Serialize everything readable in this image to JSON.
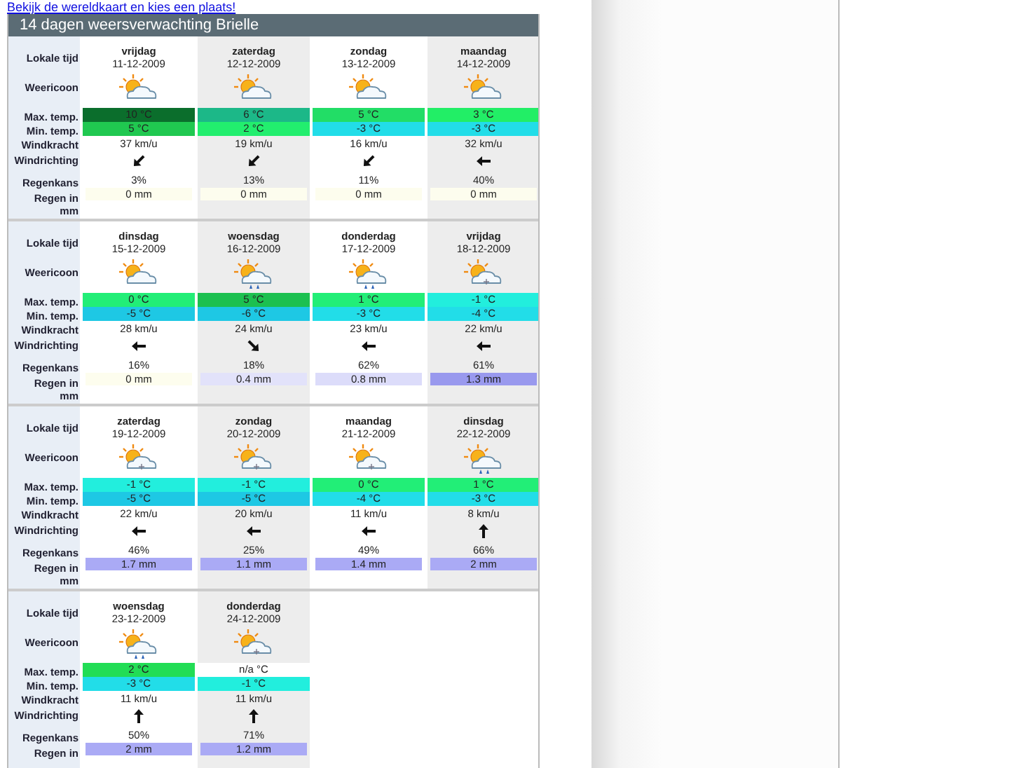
{
  "link": "Bekijk de wereldkaart en kies een plaats!",
  "title": "14 dagen weersverwachting Brielle",
  "blocks": [
    {
      "labels": [
        "Lokale tijd",
        "Weericoon",
        "Max. temp.",
        "Min. temp.",
        "Windkracht",
        "Windrichting",
        "Regenkans",
        "Regen in mm"
      ],
      "days": [
        {
          "day": "vrijdag",
          "date": "11-12-2009",
          "weather": {
            "kind": "sun-cloud"
          },
          "max": {
            "text": "10 °C",
            "color": "#0b6e2c"
          },
          "min": {
            "text": "5 °C",
            "color": "#20c850"
          },
          "wind": "37 km/u",
          "wind_arrow": {
            "kind": "down-left"
          },
          "chance": "3%",
          "rain": {
            "text": "0 mm",
            "color": "#fdfdee"
          }
        },
        {
          "day": "zaterdag",
          "date": "12-12-2009",
          "weather": {
            "kind": "sun-cloud"
          },
          "max": {
            "text": "6 °C",
            "color": "#1cb888"
          },
          "min": {
            "text": "2 °C",
            "color": "#22ee6e"
          },
          "wind": "19 km/u",
          "wind_arrow": {
            "kind": "down-left"
          },
          "chance": "13%",
          "rain": {
            "text": "0 mm",
            "color": "#fdfdee"
          }
        },
        {
          "day": "zondag",
          "date": "13-12-2009",
          "weather": {
            "kind": "sun-cloud"
          },
          "max": {
            "text": "5 °C",
            "color": "#22dd66"
          },
          "min": {
            "text": "-3 °C",
            "color": "#22dde8"
          },
          "wind": "16 km/u",
          "wind_arrow": {
            "kind": "down-left"
          },
          "chance": "11%",
          "rain": {
            "text": "0 mm",
            "color": "#fdfdee"
          }
        },
        {
          "day": "maandag",
          "date": "14-12-2009",
          "weather": {
            "kind": "sun-cloud"
          },
          "max": {
            "text": "3 °C",
            "color": "#22ee66"
          },
          "min": {
            "text": "-3 °C",
            "color": "#22dde8"
          },
          "wind": "32 km/u",
          "wind_arrow": {
            "kind": "left"
          },
          "chance": "40%",
          "rain": {
            "text": "0 mm",
            "color": "#fdfdee"
          }
        }
      ]
    },
    {
      "labels": [
        "Lokale tijd",
        "Weericoon",
        "Max. temp.",
        "Min. temp.",
        "Windkracht",
        "Windrichting",
        "Regenkans",
        "Regen in mm"
      ],
      "days": [
        {
          "day": "dinsdag",
          "date": "15-12-2009",
          "weather": {
            "kind": "sun-cloud"
          },
          "max": {
            "text": "0 °C",
            "color": "#22ee77"
          },
          "min": {
            "text": "-5 °C",
            "color": "#1ec8e4"
          },
          "wind": "28 km/u",
          "wind_arrow": {
            "kind": "left"
          },
          "chance": "16%",
          "rain": {
            "text": "0 mm",
            "color": "#fdfdee"
          }
        },
        {
          "day": "woensdag",
          "date": "16-12-2009",
          "weather": {
            "kind": "sun-cloud-rain"
          },
          "max": {
            "text": "5 °C",
            "color": "#1cc050"
          },
          "min": {
            "text": "-6 °C",
            "color": "#1ec8e4"
          },
          "wind": "24 km/u",
          "wind_arrow": {
            "kind": "down-right"
          },
          "chance": "18%",
          "rain": {
            "text": "0.4 mm",
            "color": "#e2e2fa"
          }
        },
        {
          "day": "donderdag",
          "date": "17-12-2009",
          "weather": {
            "kind": "sun-cloud-rain"
          },
          "max": {
            "text": "1 °C",
            "color": "#22ee77"
          },
          "min": {
            "text": "-3 °C",
            "color": "#22dde8"
          },
          "wind": "23 km/u",
          "wind_arrow": {
            "kind": "left"
          },
          "chance": "62%",
          "rain": {
            "text": "0.8 mm",
            "color": "#dcdcfa"
          }
        },
        {
          "day": "vrijdag",
          "date": "18-12-2009",
          "weather": {
            "kind": "sun-cloud-snow"
          },
          "max": {
            "text": "-1 °C",
            "color": "#22eedd"
          },
          "min": {
            "text": "-4 °C",
            "color": "#22dde8"
          },
          "wind": "22 km/u",
          "wind_arrow": {
            "kind": "left"
          },
          "chance": "61%",
          "rain": {
            "text": "1.3 mm",
            "color": "#9999ee"
          }
        }
      ]
    },
    {
      "labels": [
        "Lokale tijd",
        "Weericoon",
        "Max. temp.",
        "Min. temp.",
        "Windkracht",
        "Windrichting",
        "Regenkans",
        "Regen in mm"
      ],
      "days": [
        {
          "day": "zaterdag",
          "date": "19-12-2009",
          "weather": {
            "kind": "sun-cloud-snow"
          },
          "max": {
            "text": "-1 °C",
            "color": "#22eedd"
          },
          "min": {
            "text": "-5 °C",
            "color": "#1ec8e4"
          },
          "wind": "22 km/u",
          "wind_arrow": {
            "kind": "left"
          },
          "chance": "46%",
          "rain": {
            "text": "1.7 mm",
            "color": "#aaaaf5"
          }
        },
        {
          "day": "zondag",
          "date": "20-12-2009",
          "weather": {
            "kind": "sun-cloud-snow"
          },
          "max": {
            "text": "-1 °C",
            "color": "#22eedd"
          },
          "min": {
            "text": "-5 °C",
            "color": "#1ec8e4"
          },
          "wind": "20 km/u",
          "wind_arrow": {
            "kind": "left"
          },
          "chance": "25%",
          "rain": {
            "text": "1.1 mm",
            "color": "#aaaaf5"
          }
        },
        {
          "day": "maandag",
          "date": "21-12-2009",
          "weather": {
            "kind": "sun-cloud-snow"
          },
          "max": {
            "text": "0 °C",
            "color": "#22ee77"
          },
          "min": {
            "text": "-4 °C",
            "color": "#22dde8"
          },
          "wind": "11 km/u",
          "wind_arrow": {
            "kind": "left"
          },
          "chance": "49%",
          "rain": {
            "text": "1.4 mm",
            "color": "#aaaaf5"
          }
        },
        {
          "day": "dinsdag",
          "date": "22-12-2009",
          "weather": {
            "kind": "sun-cloud-rain"
          },
          "max": {
            "text": "1 °C",
            "color": "#22ee77"
          },
          "min": {
            "text": "-3 °C",
            "color": "#22dde8"
          },
          "wind": "8 km/u",
          "wind_arrow": {
            "kind": "up"
          },
          "chance": "66%",
          "rain": {
            "text": "2 mm",
            "color": "#aaaaf5"
          }
        }
      ]
    },
    {
      "labels": [
        "Lokale tijd",
        "Weericoon",
        "Max. temp.",
        "Min. temp.",
        "Windkracht",
        "Windrichting",
        "Regenkans",
        "Regen in"
      ],
      "days": [
        {
          "day": "woensdag",
          "date": "23-12-2009",
          "weather": {
            "kind": "sun-cloud-rain"
          },
          "max": {
            "text": "2 °C",
            "color": "#22dd55"
          },
          "min": {
            "text": "-3 °C",
            "color": "#22dde8"
          },
          "wind": "11 km/u",
          "wind_arrow": {
            "kind": "up"
          },
          "chance": "50%",
          "rain": {
            "text": "2 mm",
            "color": "#aaaaf5"
          }
        },
        {
          "day": "donderdag",
          "date": "24-12-2009",
          "weather": {
            "kind": "sun-cloud-snow"
          },
          "max": {
            "text": "n/a °C",
            "color": "#ffffff"
          },
          "min": {
            "text": "-1 °C",
            "color": "#22eedd"
          },
          "wind": "11 km/u",
          "wind_arrow": {
            "kind": "up"
          },
          "chance": "71%",
          "rain": {
            "text": "1.2 mm",
            "color": "#aaaaf5"
          }
        }
      ]
    }
  ]
}
